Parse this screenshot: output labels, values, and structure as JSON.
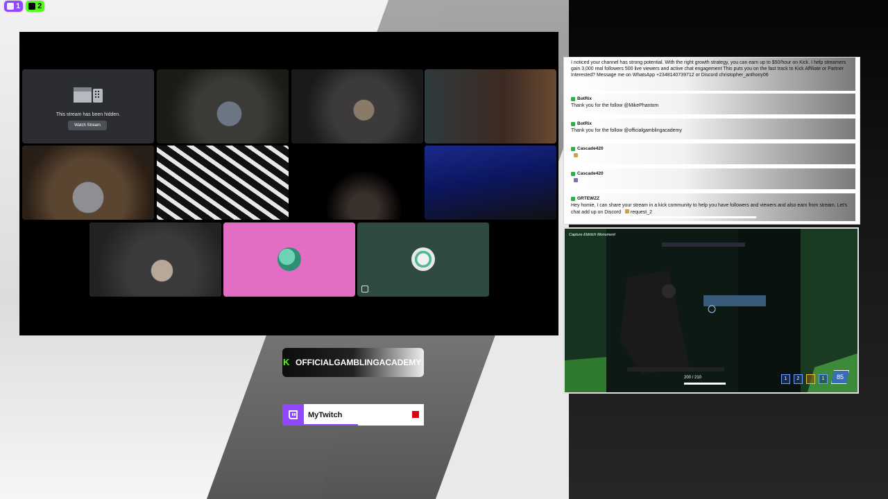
{
  "platform_badges": [
    {
      "platform": "twitch",
      "icon": "twitch-icon",
      "count": "1"
    },
    {
      "platform": "kick",
      "icon": "kick-icon",
      "count": "2"
    }
  ],
  "video_grid": {
    "hidden_tile": {
      "message": "This stream has been hidden.",
      "button": "Watch Stream"
    },
    "avatar_colors": {
      "pink_tile": "#e36cc4",
      "teal_tile": "#2f4a43"
    }
  },
  "chat": {
    "messages": [
      {
        "user": "",
        "text": "I noticed your channel has strong potential. With the right growth strategy, you can earn up to $50/hour on Kick. I help streamers gain 3,000 real followers 500 live viewers and active chat engagement This puts you on the fast track to Kick Affiliate or Partner Interested? Message me on WhatsApp +2348140739712 or Discord christopher_anthony06"
      },
      {
        "user": "BotRix",
        "text": "Thank you for the follow @MikePhantom"
      },
      {
        "user": "BotRix",
        "text": "Thank you for the follow @officialgamblingacademy"
      },
      {
        "user": "Cascade420",
        "text": ""
      },
      {
        "user": "Cascade420",
        "text": ""
      },
      {
        "user": "GRTEWZZ",
        "text": "Hey homie, I can share your stream in a kick community to help you have followers and viewers and also earn from stream. Let's chat add up on Discord",
        "mention": "request_2"
      }
    ]
  },
  "game": {
    "objective": "Capture Eldritch Monument",
    "ammo": "200 / 210",
    "abilities": [
      "1",
      "2",
      "1"
    ],
    "ult_charge": "85"
  },
  "kick_banner": {
    "name": "OFFICIALGAMBLINGACADEMY",
    "accent": "#53fc18"
  },
  "twitch_bar": {
    "label": "MyTwitch",
    "progress": 0.45,
    "accent": "#9146ff"
  }
}
